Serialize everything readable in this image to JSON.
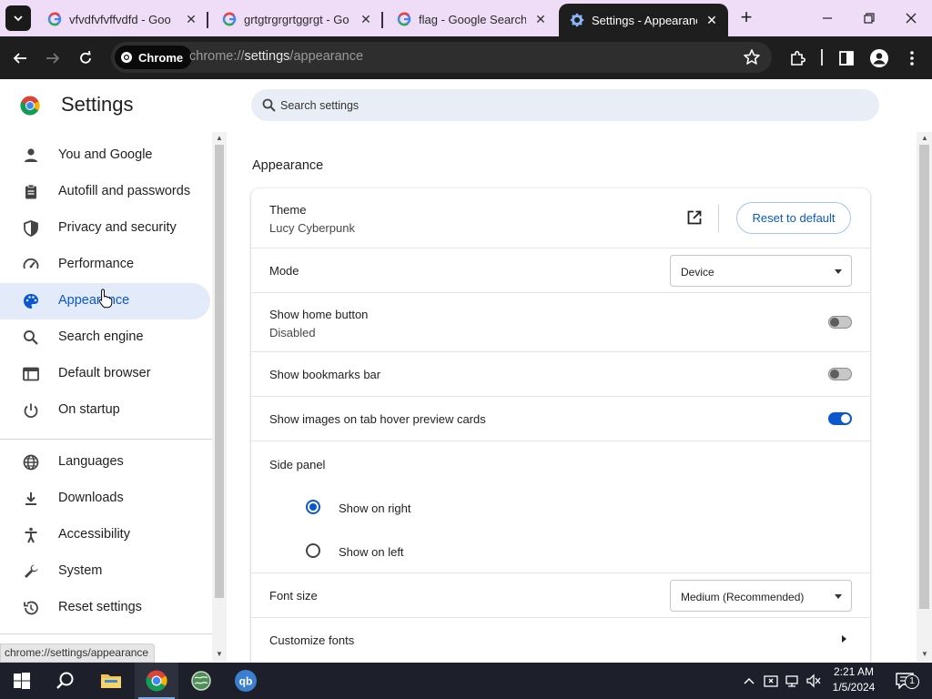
{
  "browser": {
    "tabs": [
      {
        "title": "vfvdfvfvffvdfd - Goo",
        "icon": "google-g-icon",
        "active": false
      },
      {
        "title": "grtgtrgrgrtggrgt - Go",
        "icon": "google-g-icon",
        "active": false
      },
      {
        "title": "flag - Google Search",
        "icon": "google-g-icon",
        "active": false
      },
      {
        "title": "Settings - Appearance",
        "icon": "gear-icon",
        "active": true
      }
    ],
    "omnibox": {
      "chip_label": "Chrome",
      "url_scheme": "chrome://",
      "url_host": "settings",
      "url_path": "/appearance"
    },
    "status_url": "chrome://settings/appearance"
  },
  "settings": {
    "title": "Settings",
    "search_placeholder": "Search settings",
    "sidebar": [
      {
        "label": "You and Google",
        "icon": "person-icon",
        "selected": false
      },
      {
        "label": "Autofill and passwords",
        "icon": "clipboard-icon",
        "selected": false
      },
      {
        "label": "Privacy and security",
        "icon": "shield-icon",
        "selected": false
      },
      {
        "label": "Performance",
        "icon": "speedometer-icon",
        "selected": false
      },
      {
        "label": "Appearance",
        "icon": "palette-icon",
        "selected": true
      },
      {
        "label": "Search engine",
        "icon": "search-icon",
        "selected": false
      },
      {
        "label": "Default browser",
        "icon": "browser-window-icon",
        "selected": false
      },
      {
        "label": "On startup",
        "icon": "power-icon",
        "selected": false
      },
      {
        "label": "Languages",
        "icon": "globe-icon",
        "selected": false
      },
      {
        "label": "Downloads",
        "icon": "download-icon",
        "selected": false
      },
      {
        "label": "Accessibility",
        "icon": "accessibility-icon",
        "selected": false
      },
      {
        "label": "System",
        "icon": "wrench-icon",
        "selected": false
      },
      {
        "label": "Reset settings",
        "icon": "history-icon",
        "selected": false
      }
    ],
    "section_title": "Appearance",
    "appearance": {
      "theme_label": "Theme",
      "theme_value": "Lucy Cyberpunk",
      "reset_button": "Reset to default",
      "mode_label": "Mode",
      "mode_value": "Device",
      "home_button_label": "Show home button",
      "home_button_status": "Disabled",
      "home_button_on": false,
      "bookmarks_bar_label": "Show bookmarks bar",
      "bookmarks_bar_on": false,
      "hover_cards_label": "Show images on tab hover preview cards",
      "hover_cards_on": true,
      "side_panel_label": "Side panel",
      "side_panel_options": [
        {
          "label": "Show on right",
          "checked": true
        },
        {
          "label": "Show on left",
          "checked": false
        }
      ],
      "font_size_label": "Font size",
      "font_size_value": "Medium (Recommended)",
      "customize_fonts_label": "Customize fonts"
    }
  },
  "taskbar": {
    "apps": [
      "start-icon",
      "search-icon",
      "file-explorer-icon",
      "chrome-icon",
      "globe-app-icon",
      "qbittorrent-icon"
    ],
    "time": "2:21 AM",
    "date": "1/5/2024",
    "notification_count": "1"
  },
  "colors": {
    "tab_strip": "#efdcf7",
    "toolbar": "#1e1e1e",
    "accent": "#0b57d0",
    "selected_nav_bg": "#e3ebfa",
    "search_bg": "#e9eef6",
    "taskbar": "#1d1f2b"
  }
}
